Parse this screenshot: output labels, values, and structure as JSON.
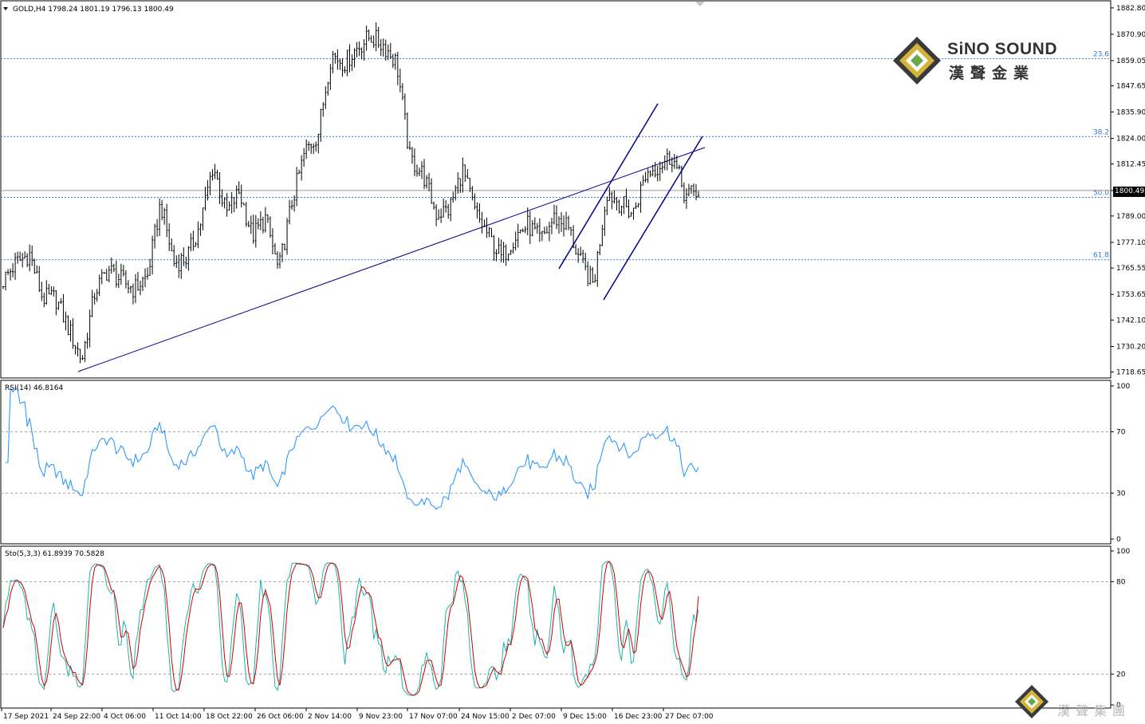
{
  "main_panel": {
    "header": "GOLD,H4  1798.24 1801.19 1796.13 1800.49",
    "current_price": "1800.49",
    "y_ticks": [
      "1882.80",
      "1870.90",
      "1859.05",
      "1847.65",
      "1835.90",
      "1824.00",
      "1812.45",
      "1800.49",
      "1789.00",
      "1777.10",
      "1765.55",
      "1753.65",
      "1742.10",
      "1730.20",
      "1718.65"
    ],
    "fib_levels": [
      {
        "label": "23.6",
        "price": 1859.9
      },
      {
        "label": "38.2",
        "price": 1824.8
      },
      {
        "label": "50.0",
        "price": 1797.4
      },
      {
        "label": "61.8",
        "price": 1769.3
      }
    ]
  },
  "rsi_panel": {
    "header": "RSI(14) 46.8164",
    "y_ticks": [
      "100",
      "70",
      "30",
      "0"
    ]
  },
  "stoch_panel": {
    "header": "Sto(5,3,3) 61.8939 70.5828",
    "y_ticks": [
      "100",
      "80",
      "20",
      "0"
    ]
  },
  "x_ticks": [
    "17 Sep 2021",
    "24 Sep 22:00",
    "4 Oct 06:00",
    "11 Oct 14:00",
    "18 Oct 22:00",
    "26 Oct 06:00",
    "2 Nov 14:00",
    "9 Nov 23:00",
    "17 Nov 07:00",
    "24 Nov 15:00",
    "2 Dec 07:00",
    "9 Dec 15:00",
    "16 Dec 23:00",
    "27 Dec 07:00"
  ],
  "logo": {
    "title": "SiNO SOUND",
    "subtitle": "漢聲金業"
  },
  "watermark": {
    "text": "漢聲集團"
  },
  "colors": {
    "price": "#000000",
    "trendline": "#00008b",
    "rsi": "#1e90ff",
    "stoch_main": "#20b2aa",
    "stoch_signal": "#cc0000",
    "fib": "#3a78c8",
    "grid": "#808080"
  },
  "chart_data": {
    "type": "candlestick",
    "title": "GOLD,H4",
    "y_range": [
      1716,
      1886
    ],
    "close_anchors": [
      {
        "x": "17 Sep 2021",
        "y": 1760
      },
      {
        "x": "20 Sep",
        "y": 1768
      },
      {
        "x": "22 Sep",
        "y": 1772
      },
      {
        "x": "23 Sep",
        "y": 1752
      },
      {
        "x": "24 Sep 22:00",
        "y": 1752
      },
      {
        "x": "28 Sep",
        "y": 1738
      },
      {
        "x": "30 Sep",
        "y": 1724
      },
      {
        "x": "1 Oct",
        "y": 1755
      },
      {
        "x": "4 Oct 06:00",
        "y": 1765
      },
      {
        "x": "6 Oct",
        "y": 1760
      },
      {
        "x": "8 Oct",
        "y": 1756
      },
      {
        "x": "11 Oct 14:00",
        "y": 1762
      },
      {
        "x": "13 Oct",
        "y": 1795
      },
      {
        "x": "15 Oct",
        "y": 1768
      },
      {
        "x": "18 Oct 22:00",
        "y": 1770
      },
      {
        "x": "20 Oct",
        "y": 1785
      },
      {
        "x": "22 Oct",
        "y": 1812
      },
      {
        "x": "25 Oct",
        "y": 1790
      },
      {
        "x": "26 Oct 06:00",
        "y": 1800
      },
      {
        "x": "28 Oct",
        "y": 1780
      },
      {
        "x": "1 Nov",
        "y": 1788
      },
      {
        "x": "2 Nov 14:00",
        "y": 1764
      },
      {
        "x": "4 Nov",
        "y": 1795
      },
      {
        "x": "5 Nov",
        "y": 1818
      },
      {
        "x": "8 Nov",
        "y": 1826
      },
      {
        "x": "9 Nov 23:00",
        "y": 1862
      },
      {
        "x": "11 Nov",
        "y": 1858
      },
      {
        "x": "12 Nov",
        "y": 1865
      },
      {
        "x": "15 Nov",
        "y": 1870
      },
      {
        "x": "16 Nov",
        "y": 1866
      },
      {
        "x": "17 Nov 07:00",
        "y": 1858
      },
      {
        "x": "18 Nov",
        "y": 1815
      },
      {
        "x": "19 Nov",
        "y": 1808
      },
      {
        "x": "22 Nov",
        "y": 1790
      },
      {
        "x": "24 Nov 15:00",
        "y": 1792
      },
      {
        "x": "25 Nov",
        "y": 1810
      },
      {
        "x": "26 Nov",
        "y": 1790
      },
      {
        "x": "29 Nov",
        "y": 1780
      },
      {
        "x": "1 Dec",
        "y": 1770
      },
      {
        "x": "2 Dec 07:00",
        "y": 1780
      },
      {
        "x": "3 Dec",
        "y": 1785
      },
      {
        "x": "6 Dec",
        "y": 1778
      },
      {
        "x": "8 Dec",
        "y": 1788
      },
      {
        "x": "9 Dec 15:00",
        "y": 1785
      },
      {
        "x": "13 Dec",
        "y": 1768
      },
      {
        "x": "15 Dec",
        "y": 1758
      },
      {
        "x": "16 Dec 23:00",
        "y": 1800
      },
      {
        "x": "20 Dec",
        "y": 1795
      },
      {
        "x": "22 Dec",
        "y": 1790
      },
      {
        "x": "23 Dec",
        "y": 1808
      },
      {
        "x": "27 Dec 07:00",
        "y": 1812
      },
      {
        "x": "28 Dec",
        "y": 1816
      },
      {
        "x": "29 Dec",
        "y": 1798
      },
      {
        "x": "30 Dec",
        "y": 1800
      }
    ],
    "indicators": {
      "rsi_period": 14,
      "rsi_last": 46.8164,
      "stoch_params": "5,3,3",
      "stoch_main_last": 61.8939,
      "stoch_signal_last": 70.5828
    }
  }
}
